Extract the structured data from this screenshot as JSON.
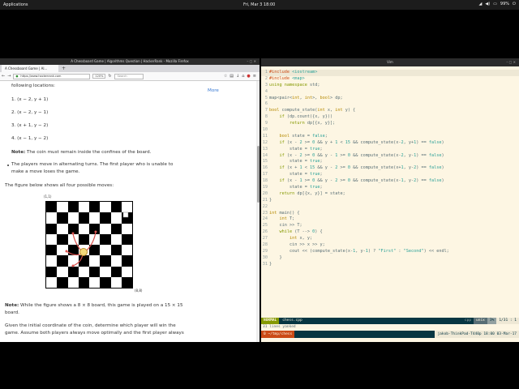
{
  "topbar": {
    "applications": "Applications",
    "clock": "Fri, Mar 3  18:00",
    "battery": "99%"
  },
  "firefox": {
    "window_title": "A Chessboard Game | Algorithms Question | HackerRank - Mozilla Firefox",
    "tab_label": "A Chessboard Game | Al...",
    "url": "https://www.hackerrank.com",
    "zoom": "120%",
    "search_placeholder": "Search",
    "page": {
      "intro": "following locations:",
      "more_link": "More",
      "moves": [
        "1. (x − 2, y + 1)",
        "2. (x − 2, y − 1)",
        "3. (x + 1, y − 2)",
        "4. (x − 1, y − 2)"
      ],
      "note1_label": "Note:",
      "note1_text": " The coin must remain inside the confines of the board.",
      "bullet1": "The players move in alternating turns. The first player who is unable to",
      "bullet1_cont": "make a move loses the game.",
      "figure_intro": "The figure below shows all four possible moves:",
      "corner_tl": "(1,1)",
      "corner_br": "(8,8)",
      "note2_label": "Note:",
      "note2_text": " While the figure shows a 8 × 8 board, this game is played on a 15 × 15",
      "note2_cont": "board.",
      "given1": "Given the initial coordinate of the coin, determine which player will win the",
      "given2": "game. Assume both players always move optimally and the first player always"
    }
  },
  "terminal": {
    "window_title": "Vim",
    "code_lines": [
      {
        "n": "1",
        "html": "<span class='pp'>#include</span> <span class='st'>&lt;iostream&gt;</span>"
      },
      {
        "n": "2",
        "html": "<span class='pp'>#include</span> <span class='st'>&lt;map&gt;</span>"
      },
      {
        "n": "3",
        "html": "<span class='kw'>using namespace</span> std;"
      },
      {
        "n": "4",
        "html": ""
      },
      {
        "n": "5",
        "html": "map&lt;pair&lt;<span class='ty'>int</span>, <span class='ty'>int</span>&gt;, <span class='ty'>bool</span>&gt; dp;"
      },
      {
        "n": "6",
        "html": ""
      },
      {
        "n": "7",
        "html": "<span class='ty'>bool</span> compute_state(<span class='ty'>int</span> x, <span class='ty'>int</span> y) {"
      },
      {
        "n": "8",
        "html": "    <span class='kw'>if</span> (dp.count({x, y}))"
      },
      {
        "n": "9",
        "html": "        <span class='kw'>return</span> dp[{x, y}];"
      },
      {
        "n": "10",
        "html": ""
      },
      {
        "n": "11",
        "html": "    <span class='ty'>bool</span> state = <span class='nu'>false</span>;"
      },
      {
        "n": "12",
        "html": "    <span class='kw'>if</span> (x - <span class='nu'>2</span> &gt;= <span class='nu'>0</span> &amp;&amp; y + <span class='nu'>1</span> &lt; <span class='nu'>15</span> &amp;&amp; compute_state(x-<span class='nu'>2</span>, y+<span class='nu'>1</span>) == <span class='nu'>false</span>)"
      },
      {
        "n": "13",
        "html": "        state = <span class='nu'>true</span>;"
      },
      {
        "n": "14",
        "html": "    <span class='kw'>if</span> (x - <span class='nu'>2</span> &gt;= <span class='nu'>0</span> &amp;&amp; y - <span class='nu'>1</span> &gt;= <span class='nu'>0</span> &amp;&amp; compute_state(x-<span class='nu'>2</span>, y-<span class='nu'>1</span>) == <span class='nu'>false</span>)"
      },
      {
        "n": "15",
        "html": "        state = <span class='nu'>true</span>;"
      },
      {
        "n": "16",
        "html": "    <span class='kw'>if</span> (x + <span class='nu'>1</span> &lt; <span class='nu'>15</span> &amp;&amp; y - <span class='nu'>2</span> &gt;= <span class='nu'>0</span> &amp;&amp; compute_state(x+<span class='nu'>1</span>, y-<span class='nu'>2</span>) == <span class='nu'>false</span>)"
      },
      {
        "n": "17",
        "html": "        state = <span class='nu'>true</span>;"
      },
      {
        "n": "18",
        "html": "    <span class='kw'>if</span> (x - <span class='nu'>1</span> &gt;= <span class='nu'>0</span> &amp;&amp; y - <span class='nu'>2</span> &gt;= <span class='nu'>0</span> &amp;&amp; compute_state(x-<span class='nu'>1</span>, y-<span class='nu'>2</span>) == <span class='nu'>false</span>)"
      },
      {
        "n": "19",
        "html": "        state = <span class='nu'>true</span>;"
      },
      {
        "n": "20",
        "html": "    <span class='kw'>return</span> dp[{x, y}] = state;"
      },
      {
        "n": "21",
        "html": "}"
      },
      {
        "n": "22",
        "html": ""
      },
      {
        "n": "23",
        "html": "<span class='ty'>int</span> main() {"
      },
      {
        "n": "24",
        "html": "    <span class='ty'>int</span> T;"
      },
      {
        "n": "25",
        "html": "    cin &gt;&gt; T;"
      },
      {
        "n": "26",
        "html": "    <span class='kw'>while</span> (T --&gt; <span class='nu'>0</span>) {"
      },
      {
        "n": "27",
        "html": "        <span class='ty'>int</span> x, y;"
      },
      {
        "n": "28",
        "html": "        cin &gt;&gt; x &gt;&gt; y;"
      },
      {
        "n": "29",
        "html": "        cout &lt;&lt; (compute_state(x-<span class='nu'>1</span>, y-<span class='nu'>1</span>) ? <span class='st'>\"First\"</span> : <span class='st'>\"Second\"</span>) &lt;&lt; endl;"
      },
      {
        "n": "30",
        "html": "    }"
      },
      {
        "n": "31",
        "html": "}"
      }
    ],
    "status": {
      "mode": "NORMAL",
      "file": "chess.cpp",
      "filetype": "cpp",
      "encoding": "unix",
      "percent": "3%",
      "position": "1/31 : 1"
    },
    "cmdline": "31 lines yanked",
    "tmux": {
      "window": "0 ~/tmp/chess",
      "right": "jakob-ThinkPad-T440p  18:00 03-Mar-17"
    }
  }
}
